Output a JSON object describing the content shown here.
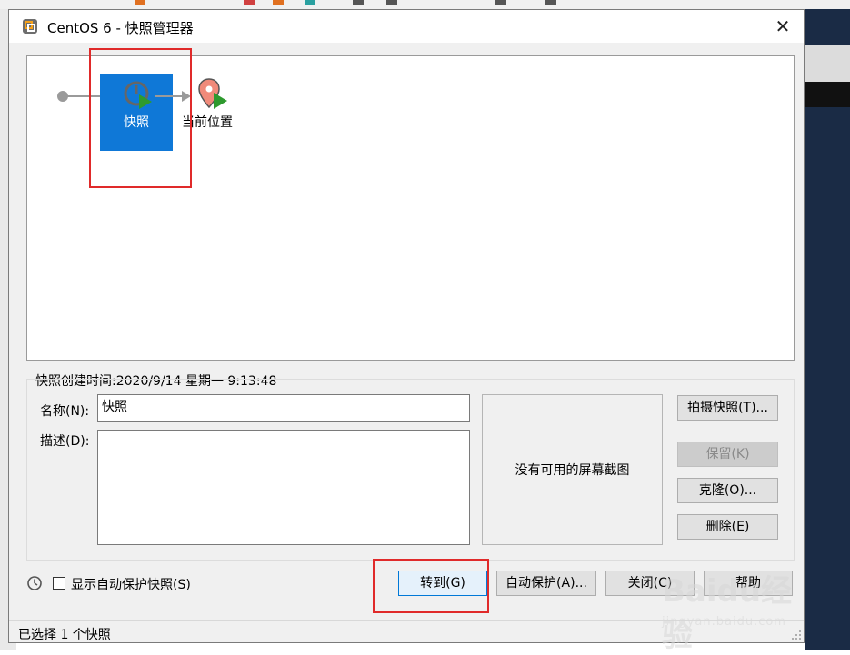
{
  "window": {
    "title": "CentOS 6 - 快照管理器",
    "close_glyph": "✕"
  },
  "tree": {
    "snapshot_label": "快照",
    "current_label": "当前位置"
  },
  "details": {
    "created_text": "快照创建时间:2020/9/14 星期一 9:13:48",
    "name_label": "名称(N):",
    "name_value": "快照",
    "desc_label": "描述(D):",
    "desc_value": "",
    "preview_text": "没有可用的屏幕截图"
  },
  "side_buttons": {
    "take": "拍摄快照(T)...",
    "keep": "保留(K)",
    "clone": "克隆(O)...",
    "delete": "删除(E)"
  },
  "bottom": {
    "show_autoprotect": "显示自动保护快照(S)",
    "goto": "转到(G)",
    "autoprotect": "自动保护(A)...",
    "close": "关闭(C)",
    "help": "帮助"
  },
  "status": {
    "text": "已选择 1 个快照"
  },
  "watermark": {
    "main": "Baidu经验",
    "sub": "jingyan.baidu.com"
  },
  "colors": {
    "selection": "#0f78d7",
    "highlight": "#e02a2a",
    "play": "#2e9a2e",
    "pin": "#f08a7a"
  }
}
